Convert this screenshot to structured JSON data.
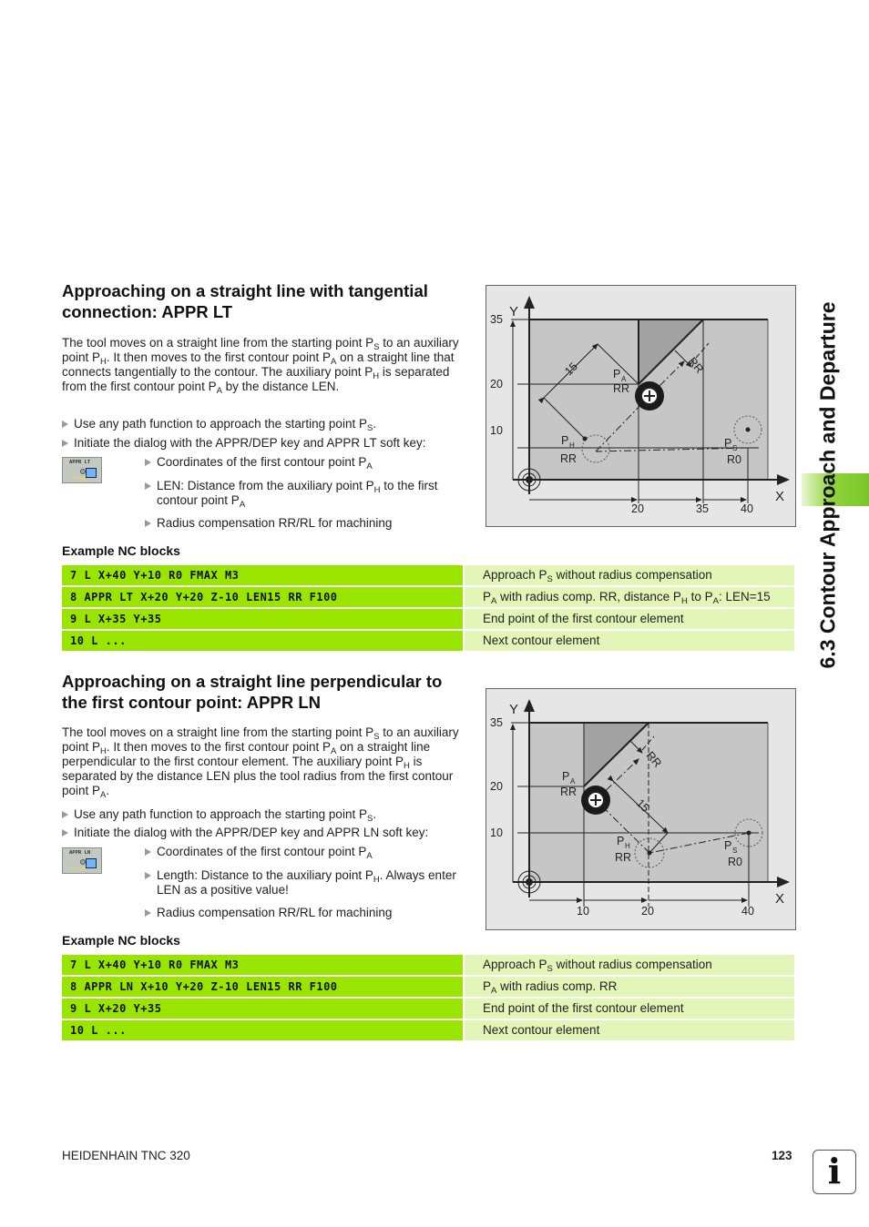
{
  "side_tab": {
    "title": "6.3 Contour Approach and Departure",
    "accent": "#8fd43a"
  },
  "sections": [
    {
      "heading": "Approaching on a straight line with tangential connection: APPR LT",
      "para": [
        "The tool moves on a straight line from the starting point P",
        {
          "sub": "S"
        },
        " to an auxiliary point P",
        {
          "sub": "H"
        },
        ". It then moves to the first contour point P",
        {
          "sub": "A"
        },
        " on a straight line that connects tangentially to the contour. The auxiliary point P",
        {
          "sub": "H"
        },
        " is separated from the first contour point P",
        {
          "sub": "A"
        },
        " by the distance LEN."
      ],
      "bullets": [
        [
          "Use any path function to approach the starting point P",
          {
            "sub": "S"
          },
          "."
        ],
        [
          "Initiate the dialog with the APPR/DEP key and APPR LT soft key:"
        ]
      ],
      "softkey": {
        "label": "APPR LT",
        "icon": "appr-lt-softkey-icon"
      },
      "sub_bullets": [
        [
          "Coordinates of the first contour point P",
          {
            "sub": "A"
          }
        ],
        [
          "LEN: Distance from the auxiliary point P",
          {
            "sub": "H"
          },
          " to the first contour point P",
          {
            "sub": "A"
          }
        ],
        [
          "Radius compensation RR/RL for machining"
        ]
      ],
      "example_label": "Example NC blocks",
      "nc_blocks": [
        {
          "code": "7 L X+40 Y+10 R0 FMAX M3",
          "desc": [
            "Approach P",
            {
              "sub": "S"
            },
            " without radius compensation"
          ]
        },
        {
          "code": "8 APPR LT X+20 Y+20 Z-10 LEN15 RR F100",
          "desc": [
            "P",
            {
              "sub": "A"
            },
            " with radius comp. RR, distance P",
            {
              "sub": "H"
            },
            " to P",
            {
              "sub": "A"
            },
            ": LEN=15"
          ]
        },
        {
          "code": "9 L X+35 Y+35",
          "desc": [
            "End point of the first contour element"
          ]
        },
        {
          "code": "10 L ...",
          "desc": [
            "Next contour element"
          ]
        }
      ],
      "diagram": {
        "axis_x": "X",
        "axis_y": "Y",
        "y_ticks": [
          "35",
          "20",
          "10"
        ],
        "x_ticks": [
          "20",
          "35",
          "40"
        ],
        "labels": {
          "pa": "P",
          "pa_sub": "A",
          "pa_rr": "RR",
          "ph": "P",
          "ph_sub": "H",
          "ph_rr": "RR",
          "ps": "P",
          "ps_sub": "S",
          "ps_r0": "R0",
          "dim": "15",
          "rr": "RR"
        }
      }
    },
    {
      "heading": "Approaching on a straight line perpendicular to the first contour point: APPR LN",
      "para": [
        "The tool moves on a straight line from the starting point P",
        {
          "sub": "S"
        },
        " to an auxiliary point P",
        {
          "sub": "H"
        },
        ". It then moves to the first contour point P",
        {
          "sub": "A"
        },
        " on a straight line perpendicular to the first contour element. The auxiliary point P",
        {
          "sub": "H"
        },
        " is separated by the distance LEN plus the tool radius from the first contour point P",
        {
          "sub": "A"
        },
        "."
      ],
      "bullets": [
        [
          "Use any path function to approach the starting point P",
          {
            "sub": "S"
          },
          "."
        ],
        [
          "Initiate the dialog with the APPR/DEP key and APPR LN soft key:"
        ]
      ],
      "softkey": {
        "label": "APPR LN",
        "icon": "appr-ln-softkey-icon"
      },
      "sub_bullets": [
        [
          "Coordinates of the first contour point P",
          {
            "sub": "A"
          }
        ],
        [
          "Length: Distance to the auxiliary point P",
          {
            "sub": "H"
          },
          ". Always enter LEN as a positive value!"
        ],
        [
          "Radius compensation RR/RL for machining"
        ]
      ],
      "example_label": "Example NC blocks",
      "nc_blocks": [
        {
          "code": "7 L X+40 Y+10 R0 FMAX M3",
          "desc": [
            "Approach P",
            {
              "sub": "S"
            },
            " without radius compensation"
          ]
        },
        {
          "code": "8 APPR LN X+10 Y+20 Z-10 LEN15 RR F100",
          "desc": [
            "P",
            {
              "sub": "A"
            },
            " with radius comp. RR"
          ]
        },
        {
          "code": "9 L X+20 Y+35",
          "desc": [
            "End point of the first contour element"
          ]
        },
        {
          "code": "10 L ...",
          "desc": [
            "Next contour element"
          ]
        }
      ],
      "diagram": {
        "axis_x": "X",
        "axis_y": "Y",
        "y_ticks": [
          "35",
          "20",
          "10"
        ],
        "x_ticks": [
          "10",
          "20",
          "40"
        ],
        "labels": {
          "pa": "P",
          "pa_sub": "A",
          "pa_rr": "RR",
          "ph": "P",
          "ph_sub": "H",
          "ph_rr": "RR",
          "ps": "P",
          "ps_sub": "S",
          "ps_r0": "R0",
          "dim": "15",
          "rr": "RR"
        }
      }
    }
  ],
  "footer": {
    "manual": "HEIDENHAIN TNC 320",
    "page_number": "123",
    "info_icon": "i"
  },
  "colors": {
    "code_bg": "#9ae500",
    "desc_bg": "#e3f6b8"
  }
}
